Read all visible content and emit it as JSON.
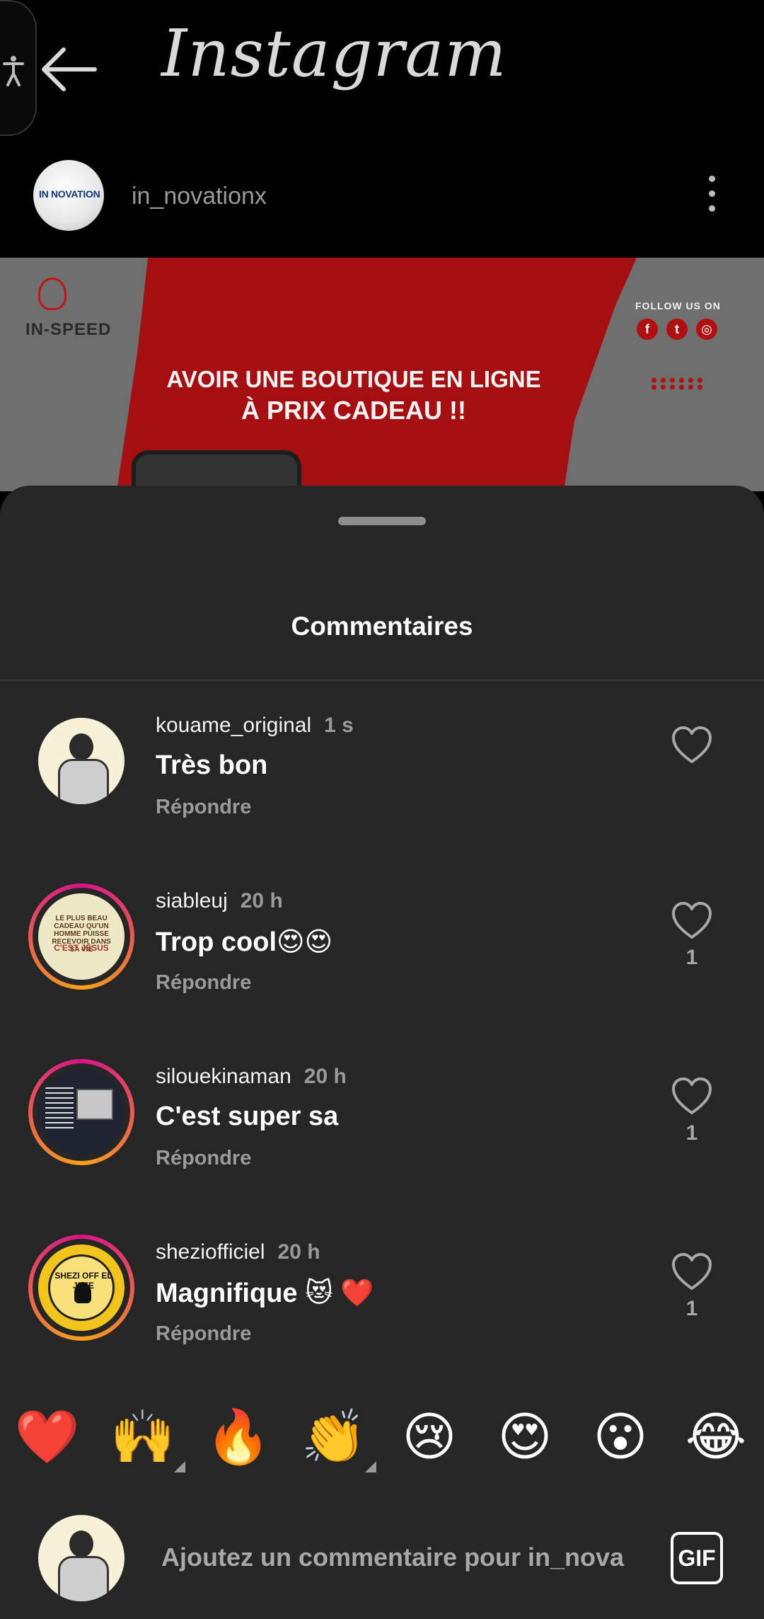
{
  "header": {
    "app_title": "Instagram"
  },
  "author": {
    "username": "in_novationx",
    "avatar_logo_text": "IN NOVATION"
  },
  "post": {
    "brand": "IN-SPEED",
    "follow_us": "FOLLOW US ON",
    "headline_line1": "AVOIR UNE BOUTIQUE EN LIGNE",
    "headline_line2": "À PRIX CADEAU !!"
  },
  "sheet": {
    "title": "Commentaires"
  },
  "comments": [
    {
      "user": "kouame_original",
      "time": "1 s",
      "text": "Très bon",
      "reply": "Répondre",
      "likes": ""
    },
    {
      "user": "siableuj",
      "time": "20 h",
      "text": "Trop cool😍😍",
      "reply": "Répondre",
      "likes": "1",
      "avatar_text1": "LE PLUS BEAU CADEAU QU'UN HOMME PUISSE RECEVOIR DANS SA VIE",
      "avatar_text2": "C'EST JÉSUS"
    },
    {
      "user": "silouekinaman",
      "time": "20 h",
      "text": "C'est super sa",
      "reply": "Répondre",
      "likes": "1"
    },
    {
      "user": "sheziofficiel",
      "time": "20 h",
      "text": "Magnifique 😻 ❤️",
      "reply": "Répondre",
      "likes": "1",
      "avatar_text": "SHEZI OFF EL JEFE"
    }
  ],
  "emoji_bar": [
    "❤️",
    "🙌",
    "🔥",
    "👏",
    "😢",
    "😍",
    "😮",
    "😂"
  ],
  "composer": {
    "placeholder": "Ajoutez un commentaire pour in_nova",
    "gif_label": "GIF"
  },
  "colors": {
    "sheet_bg": "#262626",
    "ring_start": "#d9138a",
    "ring_end": "#f7a21b",
    "muted_text": "#9a9a9a"
  }
}
